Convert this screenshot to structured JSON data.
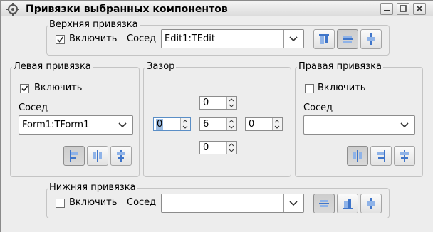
{
  "window": {
    "title": "Привязки выбранных компонентов",
    "icon": "gear-icon",
    "controls": [
      "minimize-icon",
      "maximize-icon",
      "close-icon"
    ]
  },
  "top": {
    "title": "Верхняя привязка",
    "enable_label": "Включить",
    "enabled": true,
    "neighbor_label": "Сосед",
    "neighbor_value": "Edit1:TEdit",
    "buttons": [
      "anchor-top-to-top-icon",
      "anchor-top-to-center-icon",
      "anchor-top-to-bottom-icon"
    ]
  },
  "left": {
    "title": "Левая привязка",
    "enable_label": "Включить",
    "enabled": true,
    "neighbor_label": "Сосед",
    "neighbor_value": "Form1:TForm1",
    "buttons": [
      "anchor-left-to-left-icon",
      "anchor-left-to-center-icon",
      "anchor-left-to-right-icon"
    ]
  },
  "gap": {
    "title": "Зазор",
    "top_value": "0",
    "left_value": "0",
    "center_value": "6",
    "right_value": "0",
    "bottom_value": "0"
  },
  "right": {
    "title": "Правая привязка",
    "enable_label": "Включить",
    "enabled": false,
    "neighbor_label": "Сосед",
    "neighbor_value": "",
    "buttons": [
      "anchor-right-to-left-icon",
      "anchor-right-to-center-icon",
      "anchor-right-to-right-icon"
    ]
  },
  "bottom": {
    "title": "Нижняя привязка",
    "enable_label": "Включить",
    "enabled": false,
    "neighbor_label": "Сосед",
    "neighbor_value": "",
    "buttons": [
      "anchor-bottom-to-top-icon",
      "anchor-bottom-to-center-icon",
      "anchor-bottom-to-bottom-icon"
    ]
  },
  "colors": {
    "icon_blue": "#3f75c9",
    "icon_light": "#8fb3e8",
    "focus_highlight": "#9dbde3"
  }
}
